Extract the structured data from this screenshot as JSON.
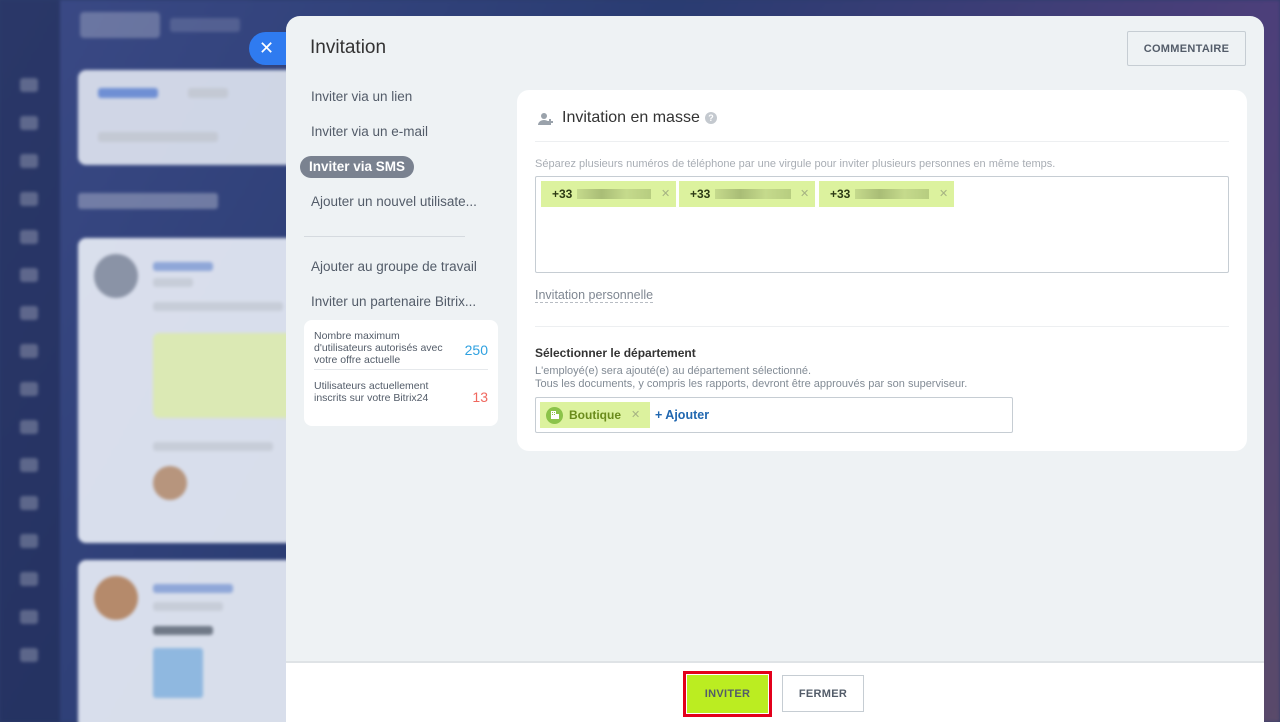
{
  "slider": {
    "title": "Invitation",
    "comment_button": "COMMENTAIRE",
    "close_icon": "close-icon"
  },
  "menu": {
    "items": [
      {
        "label": "Inviter via un lien"
      },
      {
        "label": "Inviter via un e-mail"
      },
      {
        "label": "Inviter via SMS",
        "active": true
      },
      {
        "label": "Ajouter un nouvel utilisate..."
      },
      {
        "label": "Ajouter au groupe de travail"
      },
      {
        "label": "Inviter un partenaire Bitrix..."
      }
    ],
    "stats": [
      {
        "label": "Nombre maximum d'utilisateurs autorisés avec votre offre actuelle",
        "value": "250",
        "color": "#2fa1e0"
      },
      {
        "label": "Utilisateurs actuellement inscrits sur votre Bitrix24",
        "value": "13",
        "color": "#f0685f"
      }
    ]
  },
  "card": {
    "title": "Invitation en masse",
    "help": "?",
    "hint": "Séparez plusieurs numéros de téléphone par une virgule pour inviter plusieurs personnes en même temps.",
    "phones": [
      {
        "prefix": "+33"
      },
      {
        "prefix": "+33"
      },
      {
        "prefix": "+33"
      }
    ],
    "personal_link": "Invitation personnelle",
    "department": {
      "title": "Sélectionner le département",
      "desc_line1": "L'employé(e) sera ajouté(e) au département sélectionné.",
      "desc_line2": "Tous les documents, y compris les rapports, devront être approuvés par son superviseur.",
      "selected": "Boutique",
      "add_label": "+ Ajouter"
    }
  },
  "footer": {
    "invite_button": "INVITER",
    "close_button": "FERMER"
  },
  "colors": {
    "accent_green": "#bbed21",
    "tag_green": "#dcf29e",
    "highlight_red": "#e3001b",
    "close_blue": "#2f7bf0"
  }
}
